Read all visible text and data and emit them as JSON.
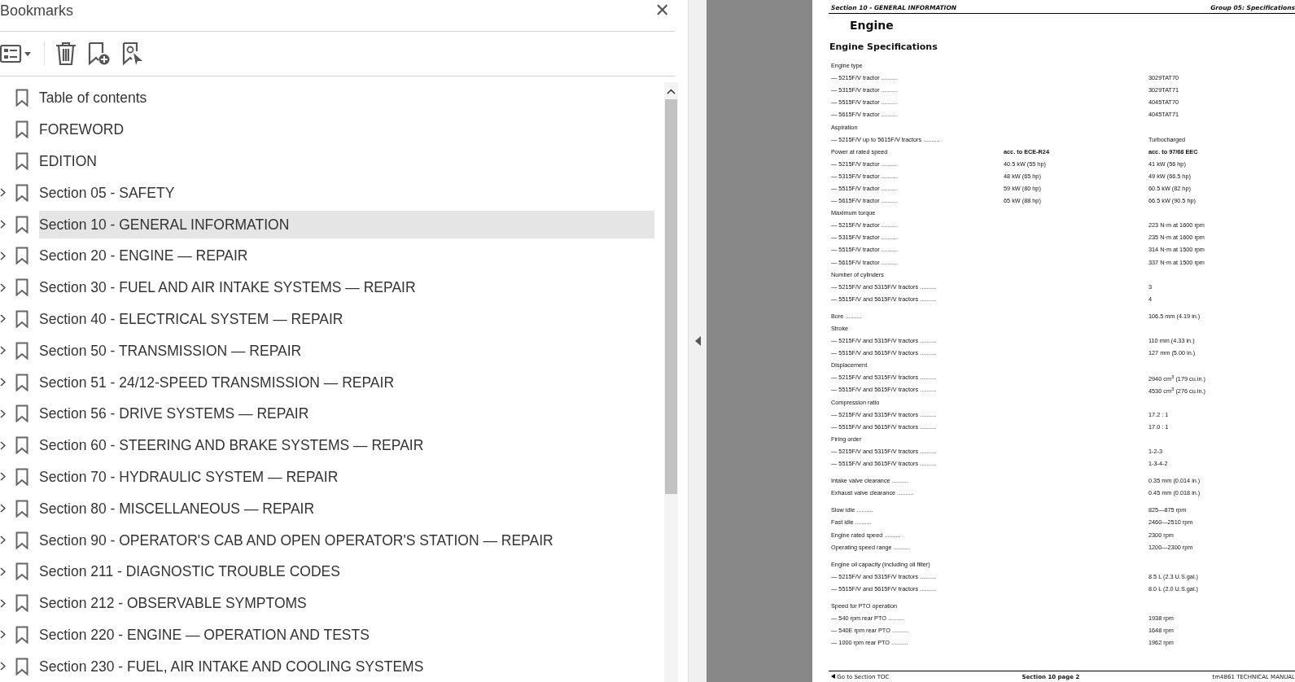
{
  "panel": {
    "title": "Bookmarks",
    "close": "✕"
  },
  "bookmarks": [
    {
      "label": "Table of contents",
      "kind": "leaf",
      "selected": false
    },
    {
      "label": "FOREWORD",
      "kind": "leaf",
      "selected": false
    },
    {
      "label": "EDITION",
      "kind": "leaf",
      "selected": false
    },
    {
      "label": "Section 05 - SAFETY",
      "kind": "folder",
      "selected": false
    },
    {
      "label": "Section 10 - GENERAL INFORMATION",
      "kind": "folder",
      "selected": true
    },
    {
      "label": "Section 20 - ENGINE — REPAIR",
      "kind": "folder",
      "selected": false
    },
    {
      "label": "Section 30 - FUEL AND AIR INTAKE SYSTEMS — REPAIR",
      "kind": "folder",
      "selected": false
    },
    {
      "label": "Section 40 - ELECTRICAL SYSTEM — REPAIR",
      "kind": "folder",
      "selected": false
    },
    {
      "label": "Section 50 - TRANSMISSION — REPAIR",
      "kind": "folder",
      "selected": false
    },
    {
      "label": "Section 51 - 24/12-SPEED TRANSMISSION — REPAIR",
      "kind": "folder",
      "selected": false
    },
    {
      "label": "Section 56 - DRIVE SYSTEMS — REPAIR",
      "kind": "folder",
      "selected": false
    },
    {
      "label": "Section 60 - STEERING AND BRAKE SYSTEMS — REPAIR",
      "kind": "folder",
      "selected": false
    },
    {
      "label": "Section 70 - HYDRAULIC SYSTEM — REPAIR",
      "kind": "folder",
      "selected": false
    },
    {
      "label": "Section 80 - MISCELLANEOUS — REPAIR",
      "kind": "folder",
      "selected": false
    },
    {
      "label": "Section 90 - OPERATOR'S CAB AND OPEN OPERATOR'S STATION — REPAIR",
      "kind": "folder",
      "selected": false
    },
    {
      "label": "Section 211 - DIAGNOSTIC TROUBLE CODES",
      "kind": "folder",
      "selected": false
    },
    {
      "label": "Section 212 - OBSERVABLE SYMPTOMS",
      "kind": "folder",
      "selected": false
    },
    {
      "label": "Section 220 - ENGINE — OPERATION AND TESTS",
      "kind": "folder",
      "selected": false
    },
    {
      "label": "Section 230 - FUEL, AIR INTAKE AND COOLING SYSTEMS",
      "kind": "folder",
      "selected": false
    }
  ],
  "page": {
    "header_left": "Section 10 - GENERAL INFORMATION",
    "header_right": "Group 05: Specifications",
    "title": "Engine",
    "subtitle": "Engine Specifications",
    "rows": [
      {
        "label": "Engine type",
        "kind": "spec"
      },
      {
        "label": "— 5215F/V tractor ..........",
        "col3": "3029TAT70",
        "kind": "spec"
      },
      {
        "label": "— 5315F/V tractor ..........",
        "col3": "3029TAT71",
        "kind": "spec"
      },
      {
        "label": "— 5515F/V tractor ..........",
        "col3": "4045TAT70",
        "kind": "spec"
      },
      {
        "label": "— 5615F/V tractor ..........",
        "col3": "4045TAT71",
        "kind": "spec"
      },
      {
        "label": "Aspiration",
        "kind": "spec"
      },
      {
        "label": "— 5215F/V up to 5615F/V tractors ..........",
        "col3": "Turbocharged",
        "kind": "spec"
      },
      {
        "label": "Power at rated speed",
        "col2": "acc. to ECE-R24",
        "col3": "acc. to 97/68 EEC",
        "kind": "column-heads"
      },
      {
        "label": "— 5215F/V tractor ..........",
        "col2": "40.5 kW (55 hp)",
        "col3": "41 kW (56 hp)",
        "kind": "spec"
      },
      {
        "label": "— 5315F/V tractor ..........",
        "col2": "48 kW (65 hp)",
        "col3": "49 kW (66.5 hp)",
        "kind": "spec"
      },
      {
        "label": "— 5515F/V tractor ..........",
        "col2": "59 kW (80 hp)",
        "col3": "60.5 kW (82 hp)",
        "kind": "spec"
      },
      {
        "label": "— 5615F/V tractor ..........",
        "col2": "65 kW (88 hp)",
        "col3": "66.5 kW (90.5 hp)",
        "kind": "spec"
      },
      {
        "label": "Maximum torque",
        "kind": "spec"
      },
      {
        "label": "— 5215F/V tractor ..........",
        "col3": "223 N·m at 1600 rpm",
        "kind": "spec"
      },
      {
        "label": "— 5315F/V tractor ..........",
        "col3": "235 N·m at 1600 rpm",
        "kind": "spec"
      },
      {
        "label": "— 5515F/V tractor ..........",
        "col3": "314 N·m at 1500 rpm",
        "kind": "spec"
      },
      {
        "label": "— 5615F/V tractor ..........",
        "col3": "337 N·m at 1500 rpm",
        "kind": "spec"
      },
      {
        "label": "Number of cylinders",
        "kind": "spec"
      },
      {
        "label": "— 5215F/V and 5315F/V tractors ..........",
        "col3": "3",
        "kind": "spec"
      },
      {
        "label": "— 5515F/V and 5615F/V tractors ..........",
        "col3": "4",
        "kind": "spec"
      },
      {
        "label": "Bore ..........",
        "col3": "106.5 mm (4.19 in.)",
        "kind": "spec",
        "spaced": true
      },
      {
        "label": "Stroke",
        "kind": "spec"
      },
      {
        "label": "— 5215F/V and 5315F/V tractors ..........",
        "col3": "110 mm (4.33 in.)",
        "kind": "spec"
      },
      {
        "label": "— 5515F/V and 5615F/V tractors ..........",
        "col3": "127 mm (5.00 in.)",
        "kind": "spec"
      },
      {
        "label": "Displacement",
        "kind": "spec"
      },
      {
        "label": "— 5215F/V and 5315F/V tractors ..........",
        "col3": "2940 cm$^{3}$ (179 cu.in.)",
        "kind": "spec"
      },
      {
        "label": "— 5515F/V and 5615F/V tractors ..........",
        "col3": "4530 cm$^{3}$ (276 cu.in.)",
        "kind": "spec"
      },
      {
        "label": "Compression ratio",
        "kind": "spec"
      },
      {
        "label": "— 5215F/V and 5315F/V tractors ..........",
        "col3": "17.2 : 1",
        "kind": "spec"
      },
      {
        "label": "— 5515F/V and 5615F/V tractors ..........",
        "col3": "17.0 : 1",
        "kind": "spec"
      },
      {
        "label": "Firing order",
        "kind": "spec"
      },
      {
        "label": "— 5215F/V and 5315F/V tractors ..........",
        "col3": "1-2-3",
        "kind": "spec"
      },
      {
        "label": "— 5515F/V and 5615F/V tractors ..........",
        "col3": "1-3-4-2",
        "kind": "spec"
      },
      {
        "label": "Intake valve clearance ..........",
        "col3": "0.35 mm (0.014 in.)",
        "kind": "spec",
        "spaced": true
      },
      {
        "label": "Exhaust valve clearance ..........",
        "col3": "0.45 mm (0.018 in.)",
        "kind": "spec"
      },
      {
        "label": "Slow idle ..........",
        "col3": "825—875 rpm",
        "kind": "spec",
        "spaced": true
      },
      {
        "label": "Fast idle ..........",
        "col3": "2460—2510 rpm",
        "kind": "spec"
      },
      {
        "label": "Engine rated speed ..........",
        "col3": "2300 rpm",
        "kind": "spec"
      },
      {
        "label": "Operating speed range ..........",
        "col3": "1200—2300 rpm",
        "kind": "spec"
      },
      {
        "label": "Engine oil capacity (including oil filter)",
        "kind": "spec",
        "spaced": true
      },
      {
        "label": "— 5215F/V and 5315F/V tractors ..........",
        "col3": "8.5 L (2.3 U.S.gal.)",
        "kind": "spec"
      },
      {
        "label": "— 5515F/V and 5615F/V tractors ..........",
        "col3": "8.0 L (2.0 U.S.gal.)",
        "kind": "spec"
      },
      {
        "label": "Speed for PTO operation",
        "kind": "spec",
        "spaced": true
      },
      {
        "label": "— 540 rpm rear PTO ..........",
        "col3": "1938 rpm",
        "kind": "spec"
      },
      {
        "label": "— 540E rpm rear PTO ..........",
        "col3": "1648 rpm",
        "kind": "spec"
      },
      {
        "label": "— 1000 rpm rear PTO ..........",
        "col3": "1962 rpm",
        "kind": "spec"
      }
    ],
    "footer_left": "Go to Section TOC",
    "footer_center": "Section 10 page 2",
    "footer_right": "tm4861 TECHNICAL MANUAL"
  }
}
